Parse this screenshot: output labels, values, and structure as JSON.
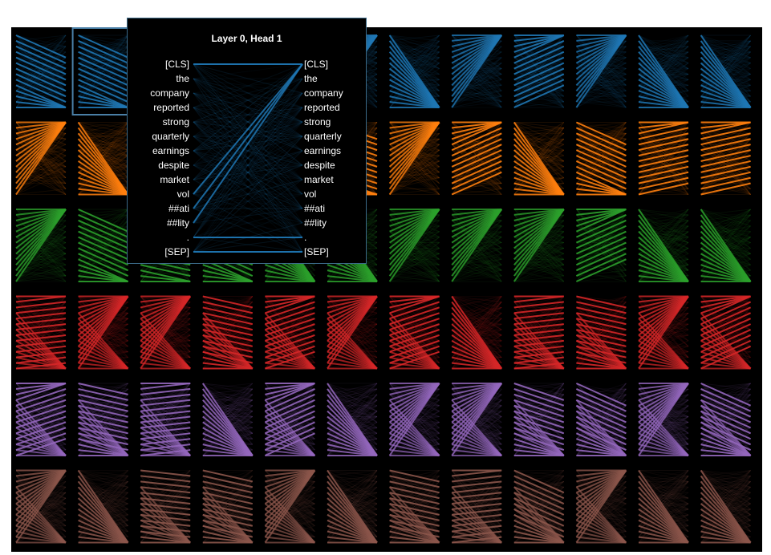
{
  "layers": 6,
  "heads": 12,
  "layer_colors": [
    "#1f77b4",
    "#ff7f0e",
    "#2ca02c",
    "#d62728",
    "#9467bd",
    "#8c564b"
  ],
  "selection_color": "#4a7fa6",
  "popup": {
    "title": "Layer 0, Head 1",
    "tokens": [
      "[CLS]",
      "the",
      "company",
      "reported",
      "strong",
      "quarterly",
      "earnings",
      "despite",
      "market",
      "vol",
      "##ati",
      "##lity",
      ".",
      "[SEP]"
    ]
  }
}
